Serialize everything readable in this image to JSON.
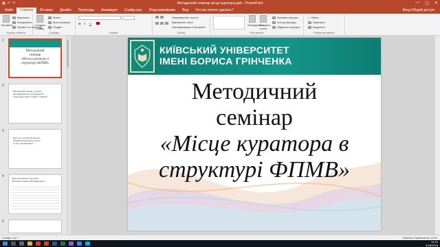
{
  "window": {
    "title": "Методичний семінар місце куратора.pptx - PowerPoint",
    "controls": [
      "—",
      "▢",
      "✕"
    ]
  },
  "tabs": [
    {
      "label": "Файл",
      "active": false
    },
    {
      "label": "Главная",
      "active": true
    },
    {
      "label": "Вставка",
      "active": false
    },
    {
      "label": "Дизайн",
      "active": false
    },
    {
      "label": "Переходы",
      "active": false
    },
    {
      "label": "Анимация",
      "active": false
    },
    {
      "label": "Слайд-шоу",
      "active": false
    },
    {
      "label": "Рецензирование",
      "active": false
    },
    {
      "label": "Вид",
      "active": false
    },
    {
      "label": "Что вы хотите сделать?",
      "active": false
    }
  ],
  "tabs_right": "Вход  Общий доступ",
  "ribbon": {
    "clipboard": {
      "label": "Буфер обмена",
      "paste": "Вставить",
      "cut": "Вырезать",
      "copy": "Копировать",
      "format": "Формат по образцу"
    },
    "slides": {
      "label": "Слайды",
      "new_slide": "Создать слайд",
      "layout": "Макет",
      "reset": "Восстановить",
      "section": "Раздел"
    },
    "font": {
      "label": "Шрифт",
      "font_name": "",
      "font_size": ""
    },
    "paragraph": {
      "label": "Абзац",
      "direction": "Направление текста",
      "align": "Выровнять текст",
      "smartart": "Преобразовать в SmartArt"
    },
    "drawing": {
      "label": "Рисование",
      "arrange": "Упорядочить",
      "styles": "Экспресс-стили",
      "fill": "Заливка фигуры",
      "outline": "Контур фигуры",
      "effects": "Эффекты фигуры"
    },
    "editing": {
      "label": "Редактирование",
      "find": "Найти",
      "replace": "Заменить",
      "select": "Выделить"
    }
  },
  "thumbnails": [
    {
      "num": "1",
      "selected": true,
      "lines": [
        "Методичний",
        "семінар",
        "«Місце куратора в",
        "структурі ФПМВ»"
      ]
    },
    {
      "num": "2",
      "selected": false,
      "lines": [
        "Методичний семінар у групах:",
        "Що відбувається на засіданнях?",
        "Чому кураторові потрібні ці знання?"
      ]
    },
    {
      "num": "3",
      "selected": false,
      "lines": [
        "Для чого потрібні методичні",
        "семінари (кураторські групи)",
        "та як їх організувати?"
      ]
    },
    {
      "num": "4",
      "selected": false,
      "lines": [
        "Загальні відомості куратора",
        "Обов'язки, права, відповідальність"
      ]
    },
    {
      "num": "5",
      "selected": false,
      "lines": []
    }
  ],
  "slide": {
    "university_line1": "КИЇВСЬКИЙ УНІВЕРСИТЕТ",
    "university_line2": "ІМЕНІ БОРИСА ГРІНЧЕНКА",
    "title_line1": "Методичний",
    "title_line2": "семінар",
    "title_line3": "«Місце куратора в",
    "title_line4": "структурі ФПМВ»"
  },
  "status": {
    "left": "Слайд 1 из 7",
    "right": "Заметки  Примечания  119%"
  },
  "taskbar": {
    "time": "14:41",
    "date": "4/26/2018",
    "icons": [
      "windows",
      "search",
      "task-view",
      "explorer",
      "chrome",
      "powerpoint",
      "word",
      "excel",
      "media",
      "photos",
      "skype"
    ]
  },
  "colors": {
    "accent": "#b7472a",
    "banner": "#14968a",
    "taskbar": "#10151d"
  }
}
